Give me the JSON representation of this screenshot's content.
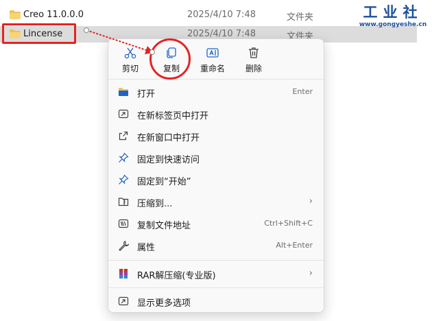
{
  "files": [
    {
      "name": "Creo 11.0.0.0",
      "date": "2025/4/10 7:48",
      "type": "文件夹"
    },
    {
      "name": "Lincense",
      "date": "2025/4/10 7:48",
      "type": "文件夹"
    }
  ],
  "watermark": {
    "text_cn": "工业社",
    "url": "www.gongyeshe.cn"
  },
  "quick_actions": {
    "cut": "剪切",
    "copy": "复制",
    "rename": "重命名",
    "delete": "删除"
  },
  "menu_items": [
    {
      "label": "打开",
      "shortcut": "Enter"
    },
    {
      "label": "在新标签页中打开",
      "shortcut": ""
    },
    {
      "label": "在新窗口中打开",
      "shortcut": ""
    },
    {
      "label": "固定到快速访问",
      "shortcut": ""
    },
    {
      "label": "固定到“开始”",
      "shortcut": ""
    },
    {
      "label": "压缩到...",
      "shortcut": ""
    },
    {
      "label": "复制文件地址",
      "shortcut": "Ctrl+Shift+C"
    },
    {
      "label": "属性",
      "shortcut": "Alt+Enter"
    },
    {
      "label": "RAR解压缩(专业版)",
      "shortcut": ""
    },
    {
      "label": "显示更多选项",
      "shortcut": ""
    }
  ],
  "colors": {
    "annotation_red": "#e52222",
    "icon_blue": "#1e64c8",
    "folder_yellow": "#f2c14e"
  }
}
